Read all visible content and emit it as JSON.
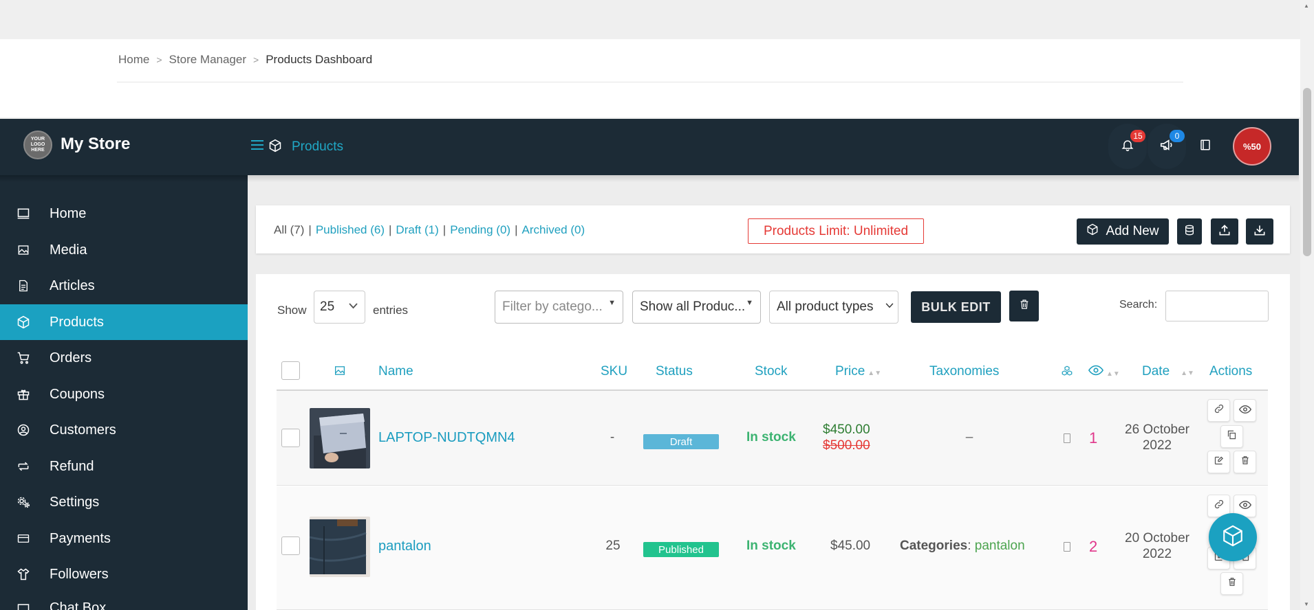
{
  "breadcrumb": {
    "home": "Home",
    "store_manager": "Store Manager",
    "current": "Products Dashboard",
    "separator": ">"
  },
  "header": {
    "logo_text": "YOUR LOGO HERE",
    "store_name": "My Store",
    "section_title": "Products",
    "notifications_count": "15",
    "announcements_count": "0",
    "avatar_text": "%50"
  },
  "sidebar": {
    "items": [
      {
        "label": "Home",
        "icon": "monitor-icon"
      },
      {
        "label": "Media",
        "icon": "image-icon"
      },
      {
        "label": "Articles",
        "icon": "document-icon"
      },
      {
        "label": "Products",
        "icon": "cube-icon",
        "active": true
      },
      {
        "label": "Orders",
        "icon": "cart-icon"
      },
      {
        "label": "Coupons",
        "icon": "gift-icon"
      },
      {
        "label": "Customers",
        "icon": "user-circle-icon"
      },
      {
        "label": "Refund",
        "icon": "refund-icon"
      },
      {
        "label": "Settings",
        "icon": "gears-icon"
      },
      {
        "label": "Payments",
        "icon": "credit-card-icon"
      },
      {
        "label": "Followers",
        "icon": "shirt-icon"
      },
      {
        "label": "Chat Box",
        "icon": "chat-icon"
      }
    ]
  },
  "status_bar": {
    "all": "All (7)",
    "published": "Published (6)",
    "draft": "Draft (1)",
    "pending": "Pending (0)",
    "archived": "Archived (0)",
    "separator": "|",
    "limit": "Products Limit: Unlimited",
    "add_new": "Add New"
  },
  "controls": {
    "show_label": "Show",
    "entries_value": "25",
    "entries_label": "entries",
    "filter_category": "Filter by catego...",
    "filter_show": "Show all Produc...",
    "filter_types": "All product types",
    "bulk_edit": "BULK EDIT",
    "search_label": "Search:"
  },
  "table": {
    "headers": {
      "name": "Name",
      "sku": "SKU",
      "status": "Status",
      "stock": "Stock",
      "price": "Price",
      "taxonomies": "Taxonomies",
      "date": "Date",
      "actions": "Actions"
    },
    "rows": [
      {
        "name": "LAPTOP-NUDTQMN4",
        "sku": "-",
        "status": "Draft",
        "stock": "In stock",
        "price_sale": "$450.00",
        "price_regular": "$500.00",
        "taxonomies": "–",
        "views": "1",
        "date_line1": "26 October",
        "date_line2": "2022"
      },
      {
        "name": "pantalon",
        "sku": "25",
        "status": "Published",
        "stock": "In stock",
        "price": "$45.00",
        "tax_label": "Categories",
        "tax_value": "pantalon",
        "views": "2",
        "date_line1": "20 October",
        "date_line2": "2022"
      }
    ]
  },
  "colors": {
    "dark": "#1c2b36",
    "accent": "#1ba1c1",
    "danger": "#e53935",
    "success": "#3cb371",
    "views": "#e0368a"
  }
}
